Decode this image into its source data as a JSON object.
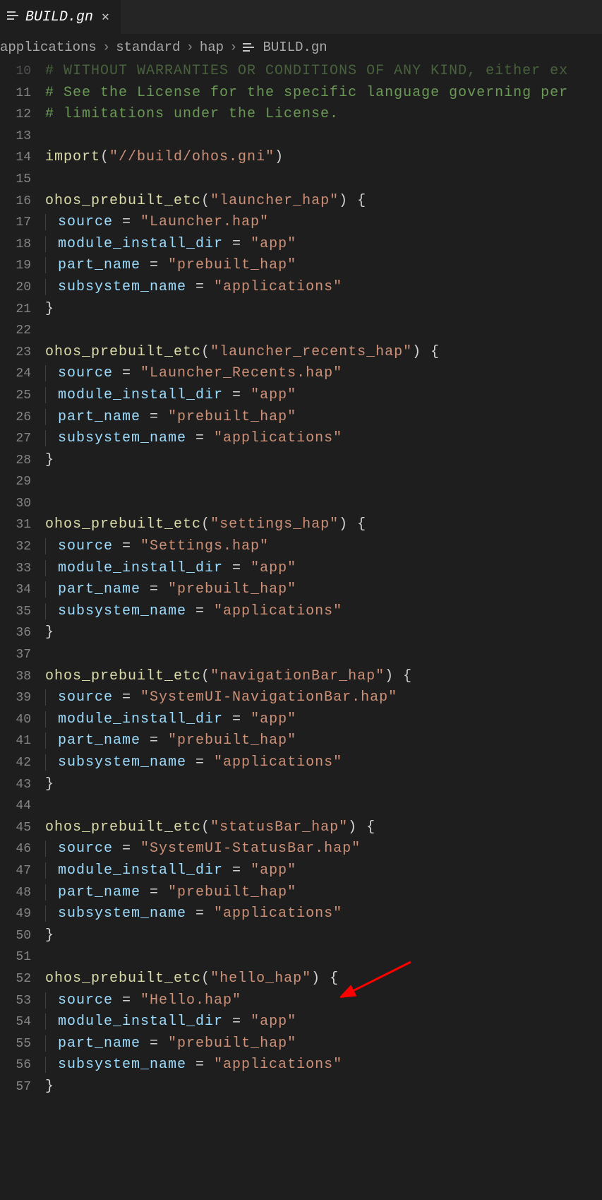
{
  "tab": {
    "label": "BUILD.gn",
    "close": "✕"
  },
  "breadcrumb": {
    "parts": [
      "applications",
      "standard",
      "hap",
      "BUILD.gn"
    ],
    "sep": "›"
  },
  "gutter": {
    "start": 10,
    "end": 57
  },
  "code": {
    "comment10": "# WITHOUT WARRANTIES OR CONDITIONS OF ANY KIND, either ex",
    "comment11": "# See the License for the specific language governing per",
    "comment12": "# limitations under the License.",
    "import_fn": "import",
    "import_arg": "\"//build/ohos.gni\"",
    "etc_fn": "ohos_prebuilt_etc",
    "kw_source": "source",
    "kw_module": "module_install_dir",
    "kw_part": "part_name",
    "kw_subsys": "subsystem_name",
    "blocks": [
      {
        "name": "\"launcher_hap\"",
        "source": "\"Launcher.hap\""
      },
      {
        "name": "\"launcher_recents_hap\"",
        "source": "\"Launcher_Recents.hap\""
      },
      {
        "name": "\"settings_hap\"",
        "source": "\"Settings.hap\""
      },
      {
        "name": "\"navigationBar_hap\"",
        "source": "\"SystemUI-NavigationBar.hap\""
      },
      {
        "name": "\"statusBar_hap\"",
        "source": "\"SystemUI-StatusBar.hap\""
      },
      {
        "name": "\"hello_hap\"",
        "source": "\"Hello.hap\""
      }
    ],
    "val_app": "\"app\"",
    "val_part": "\"prebuilt_hap\"",
    "val_subsys": "\"applications\""
  }
}
